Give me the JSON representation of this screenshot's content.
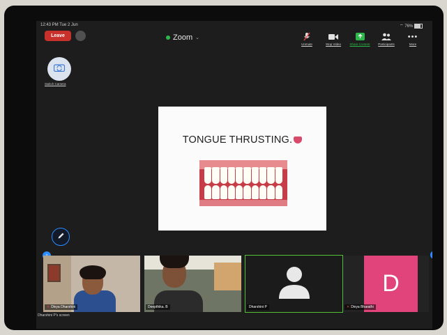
{
  "status_bar": {
    "time": "12:43 PM  Tue 2 Jun",
    "battery": "76%"
  },
  "header": {
    "leave_label": "Leave",
    "app_title": "Zoom",
    "toolbar": [
      {
        "label": "Unmute",
        "icon": "muted-mic-icon"
      },
      {
        "label": "Stop Video",
        "icon": "video-camera-icon"
      },
      {
        "label": "Share Content",
        "icon": "share-screen-icon"
      },
      {
        "label": "Participants",
        "icon": "participants-icon"
      },
      {
        "label": "More",
        "icon": "more-dots-icon"
      }
    ]
  },
  "switch_camera_label": "Switch Camera",
  "slide": {
    "title": "TONGUE THRUSTING."
  },
  "participants": [
    {
      "name": "Divya Dharshini",
      "muted": true
    },
    {
      "name": "Deepthika. B",
      "muted": false
    },
    {
      "name": "Dharshini P",
      "muted": false,
      "active_speaker": true
    },
    {
      "name": "Divya Bharathi",
      "muted": true,
      "initial": "D"
    }
  ],
  "camera_caption": "Dharshini P's screen",
  "colors": {
    "leave": "#c8312b",
    "accent": "#2d8cff",
    "active_border": "#52c234",
    "avatar_pink": "#e0447a"
  }
}
